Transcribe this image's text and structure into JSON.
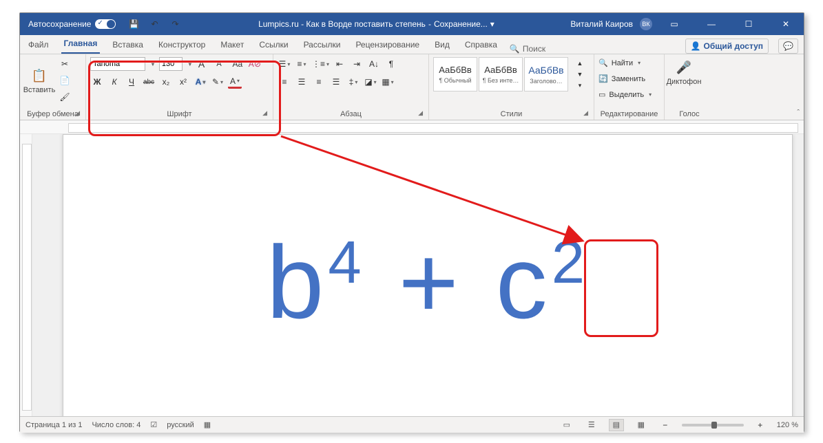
{
  "title": {
    "autosave": "Автосохранение",
    "doc_left": "Lumpics.ru - Как в Ворде поставить степень",
    "doc_right": "Сохранение...",
    "user": "Виталий Каиров",
    "initials": "ВК"
  },
  "tabs": {
    "file": "Файл",
    "home": "Главная",
    "insert": "Вставка",
    "design": "Конструктор",
    "layout": "Макет",
    "references": "Ссылки",
    "mailings": "Рассылки",
    "review": "Рецензирование",
    "view": "Вид",
    "help": "Справка",
    "search": "Поиск",
    "share": "Общий доступ"
  },
  "ribbon": {
    "clipboard": {
      "paste": "Вставить",
      "label": "Буфер обмена"
    },
    "font": {
      "name": "Tahoma",
      "size": "130",
      "grow": "A",
      "shrink": "A",
      "case": "Aa",
      "clear": "A",
      "bold": "Ж",
      "italic": "К",
      "underline": "Ч",
      "strike": "abc",
      "sub": "x₂",
      "sup": "x²",
      "effects": "A",
      "highlight": "✎",
      "color": "A",
      "label": "Шрифт"
    },
    "para": {
      "label": "Абзац"
    },
    "styles": {
      "s1": "АаБбВв",
      "s1cap": "¶ Обычный",
      "s2": "АаБбВв",
      "s2cap": "¶ Без инте…",
      "s3": "АаБбВв",
      "s3cap": "Заголово…",
      "label": "Стили"
    },
    "editing": {
      "find": "Найти",
      "replace": "Заменить",
      "select": "Выделить",
      "label": "Редактирование"
    },
    "voice": {
      "dictate": "Диктофон",
      "label": "Голос"
    }
  },
  "document": {
    "b": "b",
    "e1": "4",
    "plus": " + ",
    "c": "c",
    "e2": "2"
  },
  "status": {
    "page": "Страница 1 из 1",
    "words": "Число слов: 4",
    "lang": "русский",
    "zoom": "120 %"
  }
}
